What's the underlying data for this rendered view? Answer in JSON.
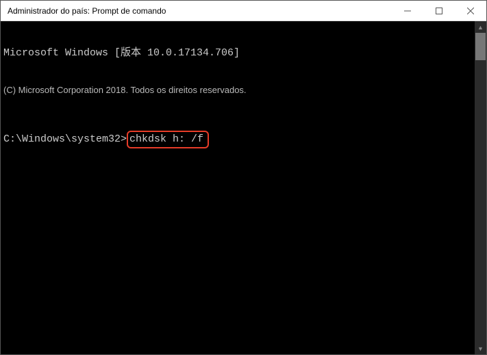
{
  "window": {
    "title": "Administrador do país: Prompt de comando"
  },
  "terminal": {
    "line1": "Microsoft Windows [版本 10.0.17134.706]",
    "copyright": "(C) Microsoft Corporation 2018. Todos os direitos reservados.",
    "prompt": "C:\\Windows\\system32>",
    "command": "chkdsk h: /f"
  }
}
